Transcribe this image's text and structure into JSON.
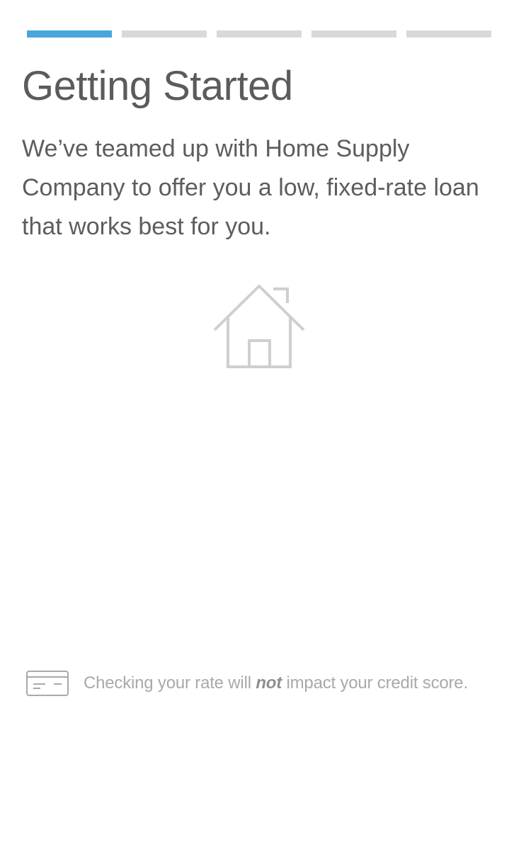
{
  "progress": {
    "total_steps": 5,
    "current_step": 1,
    "active_color": "#4aa6dc",
    "inactive_color": "#d9d9d9"
  },
  "header": {
    "title": "Getting Started"
  },
  "intro": {
    "text": "We’ve teamed up with Home Supply Company to offer you a low, fixed-rate loan that works best for you."
  },
  "illustration": {
    "icon": "house-icon"
  },
  "notice": {
    "icon": "credit-card-icon",
    "text_before": "Checking your rate will ",
    "emphasis": "not",
    "text_after": " impact your credit score."
  }
}
